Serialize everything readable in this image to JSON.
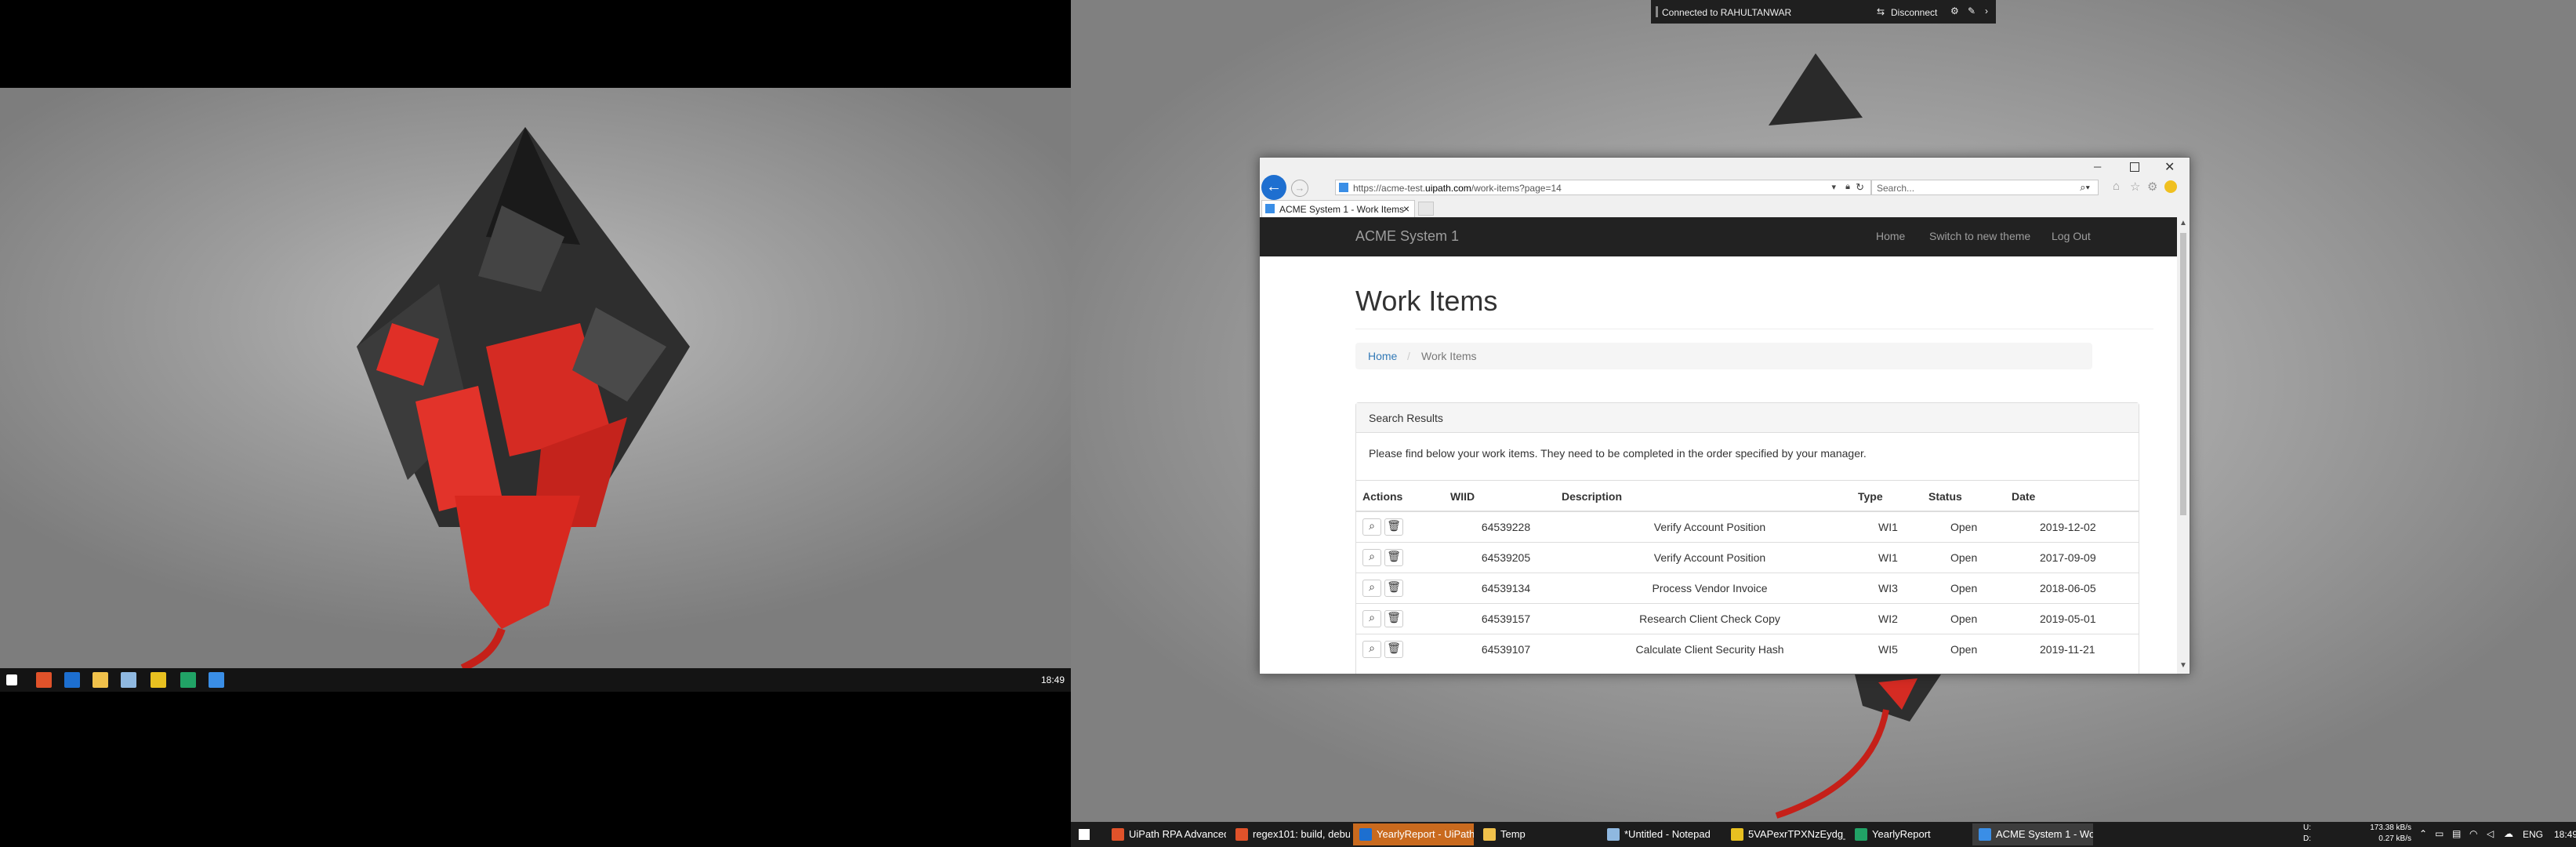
{
  "left_monitor": {
    "clock": "18:49"
  },
  "rdp_bar": {
    "connected_text": "Connected to RAHULTANWAR",
    "disconnect_label": "Disconnect"
  },
  "browser": {
    "url_prefix": "https://acme-test.",
    "url_domain": "uipath.com",
    "url_path": "/work-items?page=14",
    "search_placeholder": "Search...",
    "tab_title": "ACME System 1 - Work Items",
    "tab_close": "×"
  },
  "app": {
    "brand": "ACME System 1",
    "nav": [
      "Home",
      "Switch to new theme",
      "Log Out"
    ],
    "page_title": "Work Items",
    "breadcrumb": [
      "Home",
      "Work Items"
    ],
    "panel_heading": "Search Results",
    "panel_text": "Please find below your work items. They need to be completed in the order specified by your manager.",
    "columns": [
      "Actions",
      "WIID",
      "Description",
      "Type",
      "Status",
      "Date"
    ],
    "rows": [
      {
        "wiid": "64539228",
        "description": "Verify Account Position",
        "type": "WI1",
        "status": "Open",
        "date": "2019-12-02"
      },
      {
        "wiid": "64539205",
        "description": "Verify Account Position",
        "type": "WI1",
        "status": "Open",
        "date": "2017-09-09"
      },
      {
        "wiid": "64539134",
        "description": "Process Vendor Invoice",
        "type": "WI3",
        "status": "Open",
        "date": "2018-06-05"
      },
      {
        "wiid": "64539157",
        "description": "Research Client Check Copy",
        "type": "WI2",
        "status": "Open",
        "date": "2019-05-01"
      },
      {
        "wiid": "64539107",
        "description": "Calculate Client Security Hash",
        "type": "WI5",
        "status": "Open",
        "date": "2019-11-21"
      }
    ]
  },
  "taskbar": {
    "items": [
      {
        "label": "UiPath RPA Advanced...",
        "icon": "brave-icon",
        "color": "#e0522a"
      },
      {
        "label": "regex101: build, debu...",
        "icon": "brave-icon",
        "color": "#e0522a"
      },
      {
        "label": "YearlyReport - UiPath ...",
        "icon": "uipath-studio-icon",
        "color": "#1d6fd0"
      },
      {
        "label": "Temp",
        "icon": "folder-icon",
        "color": "#f0c14b"
      },
      {
        "label": "*Untitled - Notepad",
        "icon": "notepad-icon",
        "color": "#8fb8e0"
      },
      {
        "label": "5VAPexrTPXNzEydg_R...",
        "icon": "acrobat-icon",
        "color": "#e8c020"
      },
      {
        "label": "YearlyReport",
        "icon": "excel-icon",
        "color": "#21a366"
      },
      {
        "label": "ACME System 1 - Wo...",
        "icon": "ie-icon",
        "color": "#3a8ee6"
      }
    ],
    "net_up": "173.38 kB/s",
    "net_down": "0.27 kB/s",
    "net_up_label": "U:",
    "net_down_label": "D:",
    "lang": "ENG",
    "clock": "18:49"
  }
}
